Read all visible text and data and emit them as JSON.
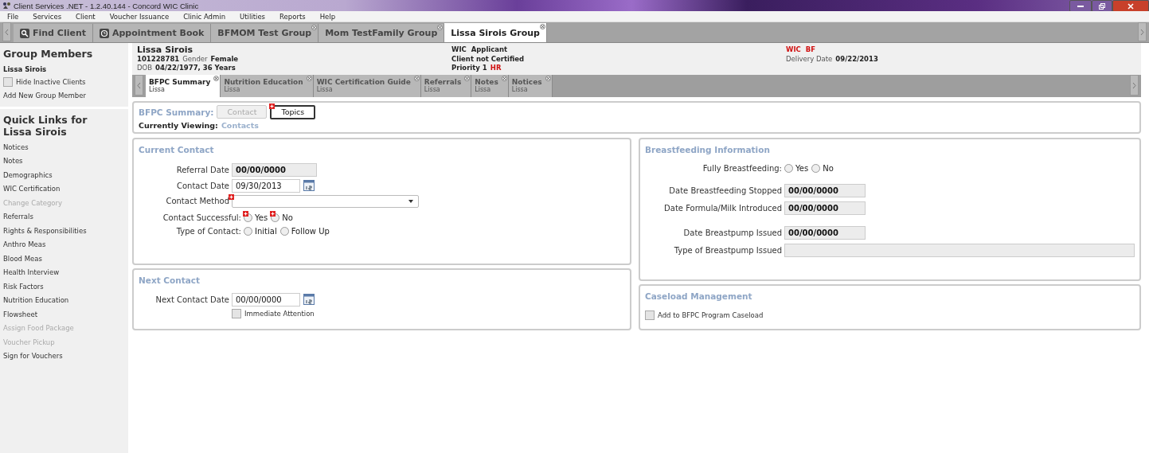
{
  "window": {
    "title": "Client Services .NET - 1.2.40.144 - Concord WIC Clinic"
  },
  "menu": [
    "File",
    "Services",
    "Client",
    "Voucher Issuance",
    "Clinic Admin",
    "Utilities",
    "Reports",
    "Help"
  ],
  "tabs": [
    {
      "label": "Find Client",
      "kind": "find",
      "selected": false
    },
    {
      "label": "Appointment Book",
      "kind": "schedule",
      "selected": false
    },
    {
      "label": "BFMOM Test Group",
      "kind": "group",
      "selected": false
    },
    {
      "label": "Mom TestFamily Group",
      "kind": "group",
      "selected": false
    },
    {
      "label": "Lissa Sirois Group",
      "kind": "group",
      "selected": true
    }
  ],
  "sidebar": {
    "members_title": "Group Members",
    "member": "Lissa Sirois",
    "hide_inactive": {
      "label": "Hide Inactive Clients",
      "checked": false
    },
    "add_member": "Add New Group Member",
    "links_title": "Quick Links for Lissa Sirois",
    "links": [
      {
        "label": "Notices",
        "disabled": false
      },
      {
        "label": "Notes",
        "disabled": false
      },
      {
        "label": "Demographics",
        "disabled": false
      },
      {
        "label": "WIC Certification",
        "disabled": false
      },
      {
        "label": "Change Category",
        "disabled": true
      },
      {
        "label": "Referrals",
        "disabled": false
      },
      {
        "label": "Rights & Responsibilities",
        "disabled": false
      },
      {
        "label": "Anthro Meas",
        "disabled": false
      },
      {
        "label": "Blood Meas",
        "disabled": false
      },
      {
        "label": "Health Interview",
        "disabled": false
      },
      {
        "label": "Risk Factors",
        "disabled": false
      },
      {
        "label": "Nutrition Education",
        "disabled": false
      },
      {
        "label": "Flowsheet",
        "disabled": false
      },
      {
        "label": "Assign Food Package",
        "disabled": true
      },
      {
        "label": "Voucher Pickup",
        "disabled": true
      },
      {
        "label": "Sign for Vouchers",
        "disabled": false
      }
    ]
  },
  "client": {
    "name": "Lissa Sirois",
    "id": "101228781",
    "gender_label": "Gender",
    "gender": "Female",
    "dob_label": "DOB",
    "dob": "04/22/1977, 36 Years",
    "program": "WIC  Applicant",
    "certification": "Client not Certified",
    "priority_label": "Priority 1",
    "priority": "HR",
    "category": "WIC  BF",
    "delivery_label": "Delivery Date",
    "delivery_date": "09/22/2013"
  },
  "inner_tabs": [
    {
      "label": "BFPC Summary",
      "sub": "Lissa",
      "selected": true
    },
    {
      "label": "Nutrition Education",
      "sub": "Lissa",
      "selected": false
    },
    {
      "label": "WIC Certification Guide",
      "sub": "Lissa",
      "selected": false
    },
    {
      "label": "Referrals",
      "sub": "Lissa",
      "selected": false
    },
    {
      "label": "Notes",
      "sub": "Lissa",
      "selected": false
    },
    {
      "label": "Notices",
      "sub": "Lissa",
      "selected": false
    }
  ],
  "summary": {
    "label": "BFPC Summary:",
    "buttons": [
      {
        "label": "Contact",
        "disabled": true,
        "required": false
      },
      {
        "label": "Topics",
        "disabled": false,
        "required": true
      }
    ],
    "viewing_label": "Currently Viewing:",
    "viewing": "Contacts"
  },
  "current_contact": {
    "title": "Current Contact",
    "referral_label": "Referral Date",
    "referral_date": "00/00/0000",
    "contact_label": "Contact Date",
    "contact_date": "09/30/2013",
    "method_label": "Contact Method",
    "successful_label": "Contact Successful:",
    "successful_options": [
      {
        "label": "Yes",
        "selected": false
      },
      {
        "label": "No",
        "selected": false
      }
    ],
    "type_label": "Type of Contact:",
    "type_options": [
      {
        "label": "Initial",
        "selected": false
      },
      {
        "label": "Follow Up",
        "selected": false
      }
    ]
  },
  "next_contact": {
    "title": "Next Contact",
    "date_label": "Next Contact Date",
    "date": "00/00/0000",
    "immediate": {
      "label": "Immediate Attention",
      "checked": false
    }
  },
  "breastfeeding": {
    "title": "Breastfeeding Information",
    "fully_label": "Fully Breastfeeding:",
    "fully_options": [
      {
        "label": "Yes",
        "selected": false
      },
      {
        "label": "No",
        "selected": false
      }
    ],
    "stopped_label": "Date Breastfeeding Stopped",
    "stopped": "00/00/0000",
    "formula_label": "Date Formula/Milk Introduced",
    "formula": "00/00/0000",
    "pump_label": "Date Breastpump Issued",
    "pump": "00/00/0000",
    "pump_type_label": "Type of Breastpump Issued"
  },
  "caseload": {
    "title": "Caseload Management",
    "add": {
      "label": "Add to BFPC Program Caseload",
      "checked": false
    }
  }
}
